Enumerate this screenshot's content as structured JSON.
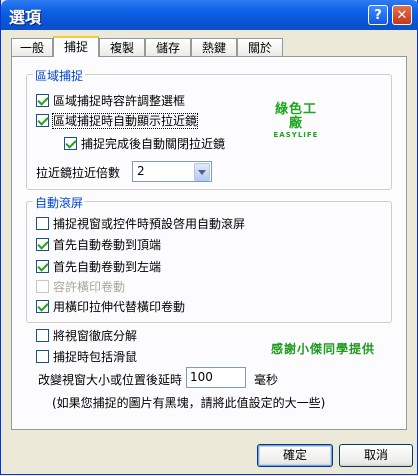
{
  "window": {
    "title": "選項",
    "help": "?",
    "close": "✕"
  },
  "tabs": [
    "一般",
    "捕捉",
    "複製",
    "儲存",
    "熱鍵",
    "關於"
  ],
  "region_group": {
    "title": "區域捕捉",
    "opt_resize": "區域捕捉時容許調整選框",
    "opt_magnifier": "區域捕捉時自動顯示拉近鏡",
    "opt_close_mag": "捕捉完成後自動關閉拉近鏡",
    "zoom_label": "拉近鏡拉近倍數",
    "zoom_value": "2"
  },
  "brand": {
    "cn": "綠色工廠",
    "en": "EASYLIFE"
  },
  "scroll_group": {
    "title": "自動滾屏",
    "opt_default_scroll": "捕捉視窗或控件時預設啓用自動滾屏",
    "opt_scroll_top": "首先自動卷動到頂端",
    "opt_scroll_left": "首先自動卷動到左端",
    "opt_horizontal": "容許橫印卷動",
    "opt_print_extend": "用橫印拉伸代替橫印卷動"
  },
  "misc": {
    "opt_decompose": "將視窗徹底分解",
    "opt_include_cursor": "捕捉時包括滑鼠",
    "delay_label": "改變視窗大小或位置後延時",
    "delay_value": "100",
    "delay_unit": "毫秒",
    "note": "(如果您捕捉的圖片有黑塊，請將此值設定的大一些)",
    "thanks": "感謝小傑同學提供"
  },
  "buttons": {
    "ok": "確定",
    "cancel": "取消"
  }
}
